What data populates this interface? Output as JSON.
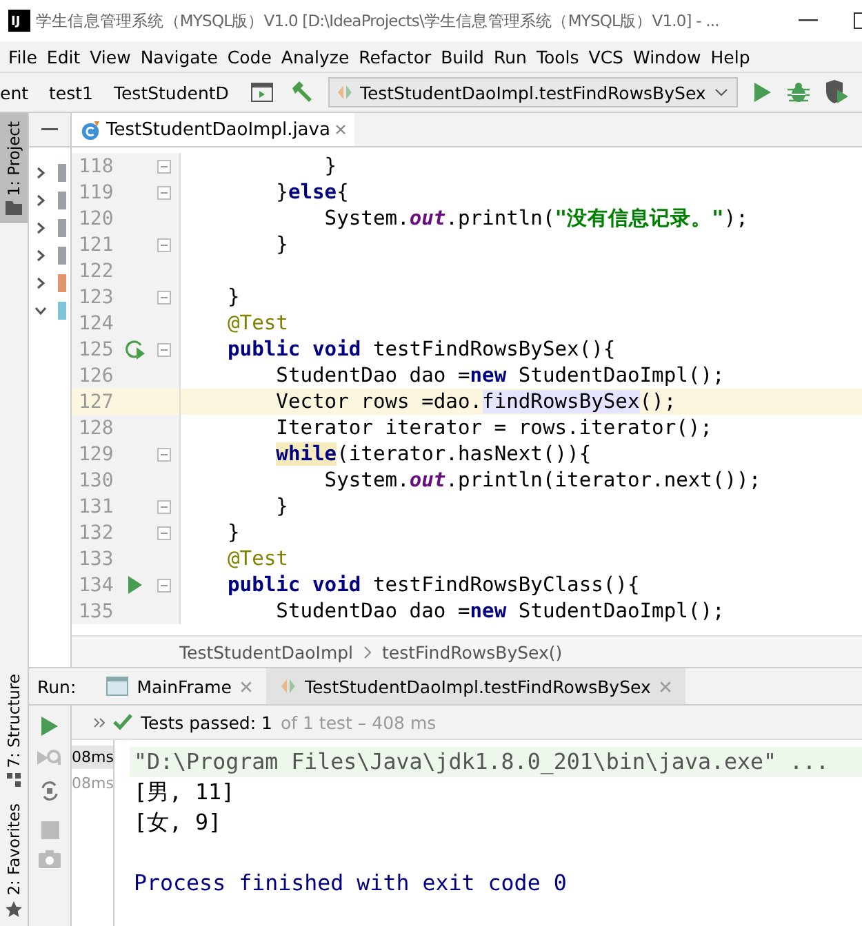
{
  "window": {
    "logo": "IJ",
    "title": "学生信息管理系统（MYSQL版）V1.0 [D:\\IdeaProjects\\学生信息管理系统（MYSQL版）V1.0] - ..."
  },
  "menu": [
    "File",
    "Edit",
    "View",
    "Navigate",
    "Code",
    "Analyze",
    "Refactor",
    "Build",
    "Run",
    "Tools",
    "VCS",
    "Window",
    "Help"
  ],
  "navbar": {
    "crumbs": [
      {
        "label": "ent",
        "kind": "text"
      },
      {
        "label": "test1",
        "kind": "folder"
      },
      {
        "label": "TestStudentD",
        "kind": "class"
      }
    ],
    "run_config": "TestStudentDaoImpl.testFindRowsBySex"
  },
  "tool_tabs": {
    "top": [
      {
        "label": "1: Project",
        "selected": true
      }
    ],
    "bottom": [
      {
        "label": "7: Structure",
        "selected": false
      },
      {
        "label": "2: Favorites",
        "selected": false
      }
    ]
  },
  "project_tree": [
    {
      "expanded": false,
      "color": "#9aa0a6"
    },
    {
      "expanded": false,
      "color": "#9aa0a6"
    },
    {
      "expanded": false,
      "color": "#9aa0a6"
    },
    {
      "expanded": false,
      "color": "#9aa0a6"
    },
    {
      "expanded": false,
      "color": "#e0956a"
    },
    {
      "expanded": true,
      "color": "#7ec4d6"
    }
  ],
  "editor": {
    "tabs": [
      {
        "label": "TestStudentDaoImpl.java",
        "selected": true
      }
    ],
    "lines": [
      {
        "number": "118",
        "fold": true,
        "current": false,
        "tokens": [
          {
            "t": "        }",
            "kind": "plain"
          }
        ]
      },
      {
        "number": "119",
        "fold": true,
        "current": false,
        "tokens": [
          {
            "t": "    }",
            "kind": "plain"
          },
          {
            "t": "else",
            "kind": "keyword"
          },
          {
            "t": "{",
            "kind": "plain"
          }
        ]
      },
      {
        "number": "120",
        "fold": false,
        "current": false,
        "tokens": [
          {
            "t": "        System.",
            "kind": "plain"
          },
          {
            "t": "out",
            "kind": "field"
          },
          {
            "t": ".println(",
            "kind": "plain"
          },
          {
            "t": "\"没有信息记录。\"",
            "kind": "string"
          },
          {
            "t": ");",
            "kind": "plain"
          }
        ]
      },
      {
        "number": "121",
        "fold": true,
        "current": false,
        "tokens": [
          {
            "t": "    }",
            "kind": "plain"
          }
        ]
      },
      {
        "number": "122",
        "fold": false,
        "current": false
      },
      {
        "number": "123",
        "fold": true,
        "current": false,
        "tokens": [
          {
            "t": "}",
            "kind": "plain"
          }
        ]
      },
      {
        "number": "124",
        "fold": false,
        "current": false,
        "tokens": [
          {
            "t": "@Test",
            "kind": "annotation"
          }
        ]
      },
      {
        "number": "125",
        "fold": true,
        "current": false,
        "gutter": {
          "kind": "rerun"
        },
        "tokens": [
          {
            "t": "public void",
            "kind": "keyword"
          },
          {
            "t": " testFindRowsBySex(){",
            "kind": "plain"
          }
        ]
      },
      {
        "number": "126",
        "fold": false,
        "current": false,
        "tokens": [
          {
            "t": "    StudentDao dao =",
            "kind": "plain"
          },
          {
            "t": "new",
            "kind": "keyword"
          },
          {
            "t": " StudentDaoImpl();",
            "kind": "plain"
          }
        ]
      },
      {
        "number": "127",
        "fold": false,
        "current": true,
        "tokens": [
          {
            "t": "    Vector rows =dao.",
            "kind": "plain"
          },
          {
            "t": "findRowsBySex",
            "kind": "usage"
          },
          {
            "t": "();",
            "kind": "plain"
          }
        ]
      },
      {
        "number": "128",
        "fold": false,
        "current": false,
        "tokens": [
          {
            "t": "    Iterator iterator = rows.iterator();",
            "kind": "plain"
          }
        ]
      },
      {
        "number": "129",
        "fold": true,
        "current": false,
        "tokens": [
          {
            "t": "    while",
            "kind": "keyword_match"
          },
          {
            "t": "(iterator.hasNext()){",
            "kind": "plain"
          }
        ]
      },
      {
        "number": "130",
        "fold": false,
        "current": false,
        "tokens": [
          {
            "t": "        System.",
            "kind": "plain"
          },
          {
            "t": "out",
            "kind": "field"
          },
          {
            "t": ".println(iterator.next());",
            "kind": "plain"
          }
        ]
      },
      {
        "number": "131",
        "fold": true,
        "current": false,
        "tokens": [
          {
            "t": "    }",
            "kind": "plain"
          }
        ]
      },
      {
        "number": "132",
        "fold": true,
        "current": false,
        "tokens": [
          {
            "t": "}",
            "kind": "plain"
          }
        ]
      },
      {
        "number": "133",
        "fold": false,
        "current": false,
        "tokens": [
          {
            "t": "@Test",
            "kind": "annotation"
          }
        ]
      },
      {
        "number": "134",
        "fold": true,
        "current": false,
        "gutter": {
          "kind": "run"
        },
        "tokens": [
          {
            "t": "public void",
            "kind": "keyword"
          },
          {
            "t": " testFindRowsByClass(){",
            "kind": "plain"
          }
        ]
      },
      {
        "number": "135",
        "fold": false,
        "current": false,
        "tokens": [
          {
            "t": "    StudentDao dao =",
            "kind": "plain"
          },
          {
            "t": "new",
            "kind": "keyword"
          },
          {
            "t": " StudentDaoImpl();",
            "kind": "plain"
          }
        ]
      }
    ],
    "breadcrumb": [
      "TestStudentDaoImpl",
      "testFindRowsBySex()"
    ]
  },
  "run": {
    "label": "Run:",
    "tabs": [
      {
        "label": "MainFrame",
        "kind": "app",
        "selected": false
      },
      {
        "label": "TestStudentDaoImpl.testFindRowsBySex",
        "kind": "test",
        "selected": true
      }
    ],
    "status": {
      "passed": "Tests passed: 1",
      "detail": "of 1 test – 408 ms"
    },
    "tests": [
      {
        "time": "08ms",
        "selected": true
      },
      {
        "time": "08ms",
        "selected": false
      }
    ],
    "console": [
      {
        "text": "\"D:\\Program Files\\Java\\jdk1.8.0_201\\bin\\java.exe\" ...",
        "kind": "command"
      },
      {
        "text": "[男, 11]",
        "kind": "output"
      },
      {
        "text": "[女, 9]",
        "kind": "output"
      },
      {
        "kind": "blank"
      },
      {
        "text": "Process finished with exit code 0",
        "kind": "system"
      }
    ]
  }
}
